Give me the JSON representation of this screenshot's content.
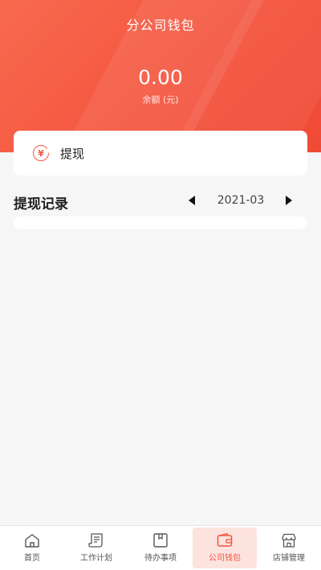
{
  "header": {
    "title": "分公司钱包",
    "balance": "0.00",
    "balance_label": "余额 (元)"
  },
  "withdraw_card": {
    "icon": "yen-refresh-icon",
    "label": "提现"
  },
  "records": {
    "title": "提现记录",
    "month": "2021-03",
    "items": []
  },
  "bottom_nav": {
    "items": [
      {
        "label": "首页",
        "icon": "home-icon"
      },
      {
        "label": "工作计划",
        "icon": "plan-icon"
      },
      {
        "label": "待办事项",
        "icon": "todo-icon"
      },
      {
        "label": "公司钱包",
        "icon": "wallet-icon",
        "active": true
      },
      {
        "label": "店铺管理",
        "icon": "store-icon"
      }
    ]
  },
  "colors": {
    "accent": "#f4553f",
    "header_gradient_start": "#f86a4f",
    "header_gradient_end": "#ef4a36"
  }
}
